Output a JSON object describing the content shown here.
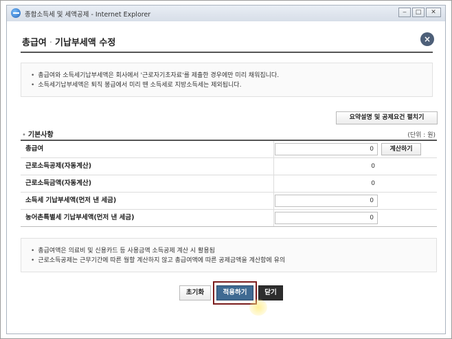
{
  "window": {
    "title": "종합소득세 및 세액공제 - Internet Explorer",
    "min_symbol": "‒",
    "max_symbol": "□",
    "close_symbol": "✕"
  },
  "popup": {
    "title_main": "총급여",
    "title_sep": "·",
    "title_sub": "기납부세액 수정",
    "close_symbol": "×"
  },
  "notices": [
    "총급여와 소득세기납부세액은 회사에서 '근로자기초자료'를 제출한 경우에만 미리 채워집니다.",
    "소득세기납부세액은 퇴직 봉급에서 미리 뗀 소득세로 지방소득세는 제외됩니다."
  ],
  "summary_button": "요약설명 및 공제요건 펼치기",
  "section": {
    "title": "기본사항",
    "unit": "(단위 : 원)"
  },
  "rows": [
    {
      "label": "총급여",
      "value": "0",
      "button": "계산하기"
    },
    {
      "label": "근로소득공제(자동계산)",
      "value": "0"
    },
    {
      "label": "근로소득금액(자동계산)",
      "value": "0"
    },
    {
      "label": "소득세 기납부세액(먼저 낸 세금)",
      "value": "0"
    },
    {
      "label": "농어촌특별세 기납부세액(먼저 낸 세금)",
      "value": "0"
    }
  ],
  "bottom_notices": [
    "총급여액은 의료비 및 신용카드 등 사용금액 소득공제 계산 시 활용됨",
    "근로소득공제는 근무기간에 따른 월할 계산하지 않고 총급여액에 따른 공제금액을 계산함에 유의"
  ],
  "actions": {
    "reset": "초기화",
    "apply": "적용하기",
    "close": "닫기"
  },
  "colors": {
    "apply_bg": "#3f6a92",
    "close_bg": "#2d2d2d",
    "highlight_border": "#7b1d1d",
    "close_circle": "#4d5f78"
  }
}
